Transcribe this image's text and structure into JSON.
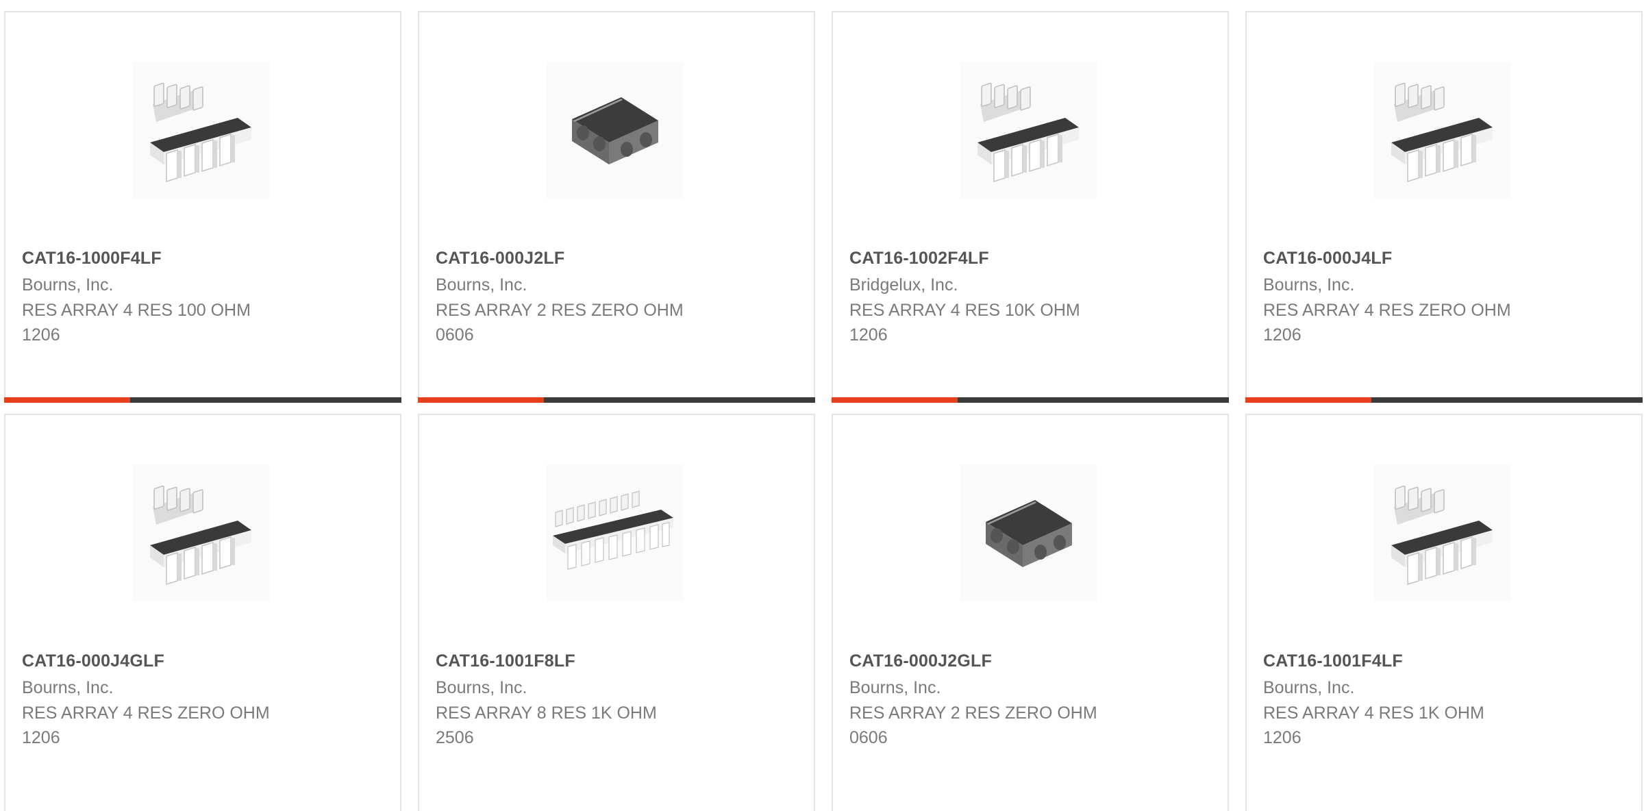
{
  "colors": {
    "accent": "#e8401c",
    "bar_dark": "#3b3b3b",
    "card_border": "#e3e3e3",
    "title_text": "#555555",
    "body_text": "#7a7a7a"
  },
  "products": [
    {
      "part_number": "CAT16-1000F4LF",
      "manufacturer": "Bourns, Inc.",
      "description": "RES ARRAY 4 RES 100 OHM",
      "package": "1206",
      "image_icon": "resistor-array-4-icon",
      "show_progress_bar": true
    },
    {
      "part_number": "CAT16-000J2LF",
      "manufacturer": "Bourns, Inc.",
      "description": "RES ARRAY 2 RES ZERO OHM",
      "package": "0606",
      "image_icon": "resistor-array-2-icon",
      "show_progress_bar": true
    },
    {
      "part_number": "CAT16-1002F4LF",
      "manufacturer": "Bridgelux, Inc.",
      "description": "RES ARRAY 4 RES 10K OHM",
      "package": "1206",
      "image_icon": "resistor-array-4-icon",
      "show_progress_bar": true
    },
    {
      "part_number": "CAT16-000J4LF",
      "manufacturer": "Bourns, Inc.",
      "description": "RES ARRAY 4 RES ZERO OHM",
      "package": "1206",
      "image_icon": "resistor-array-4-icon",
      "show_progress_bar": true
    },
    {
      "part_number": "CAT16-000J4GLF",
      "manufacturer": "Bourns, Inc.",
      "description": "RES ARRAY 4 RES ZERO OHM",
      "package": "1206",
      "image_icon": "resistor-array-4-icon",
      "show_progress_bar": false
    },
    {
      "part_number": "CAT16-1001F8LF",
      "manufacturer": "Bourns, Inc.",
      "description": "RES ARRAY 8 RES 1K OHM",
      "package": "2506",
      "image_icon": "resistor-array-8-icon",
      "show_progress_bar": false
    },
    {
      "part_number": "CAT16-000J2GLF",
      "manufacturer": "Bourns, Inc.",
      "description": "RES ARRAY 2 RES ZERO OHM",
      "package": "0606",
      "image_icon": "resistor-array-2-icon",
      "show_progress_bar": false
    },
    {
      "part_number": "CAT16-1001F4LF",
      "manufacturer": "Bourns, Inc.",
      "description": "RES ARRAY 4 RES 1K OHM",
      "package": "1206",
      "image_icon": "resistor-array-4-icon",
      "show_progress_bar": false
    }
  ]
}
